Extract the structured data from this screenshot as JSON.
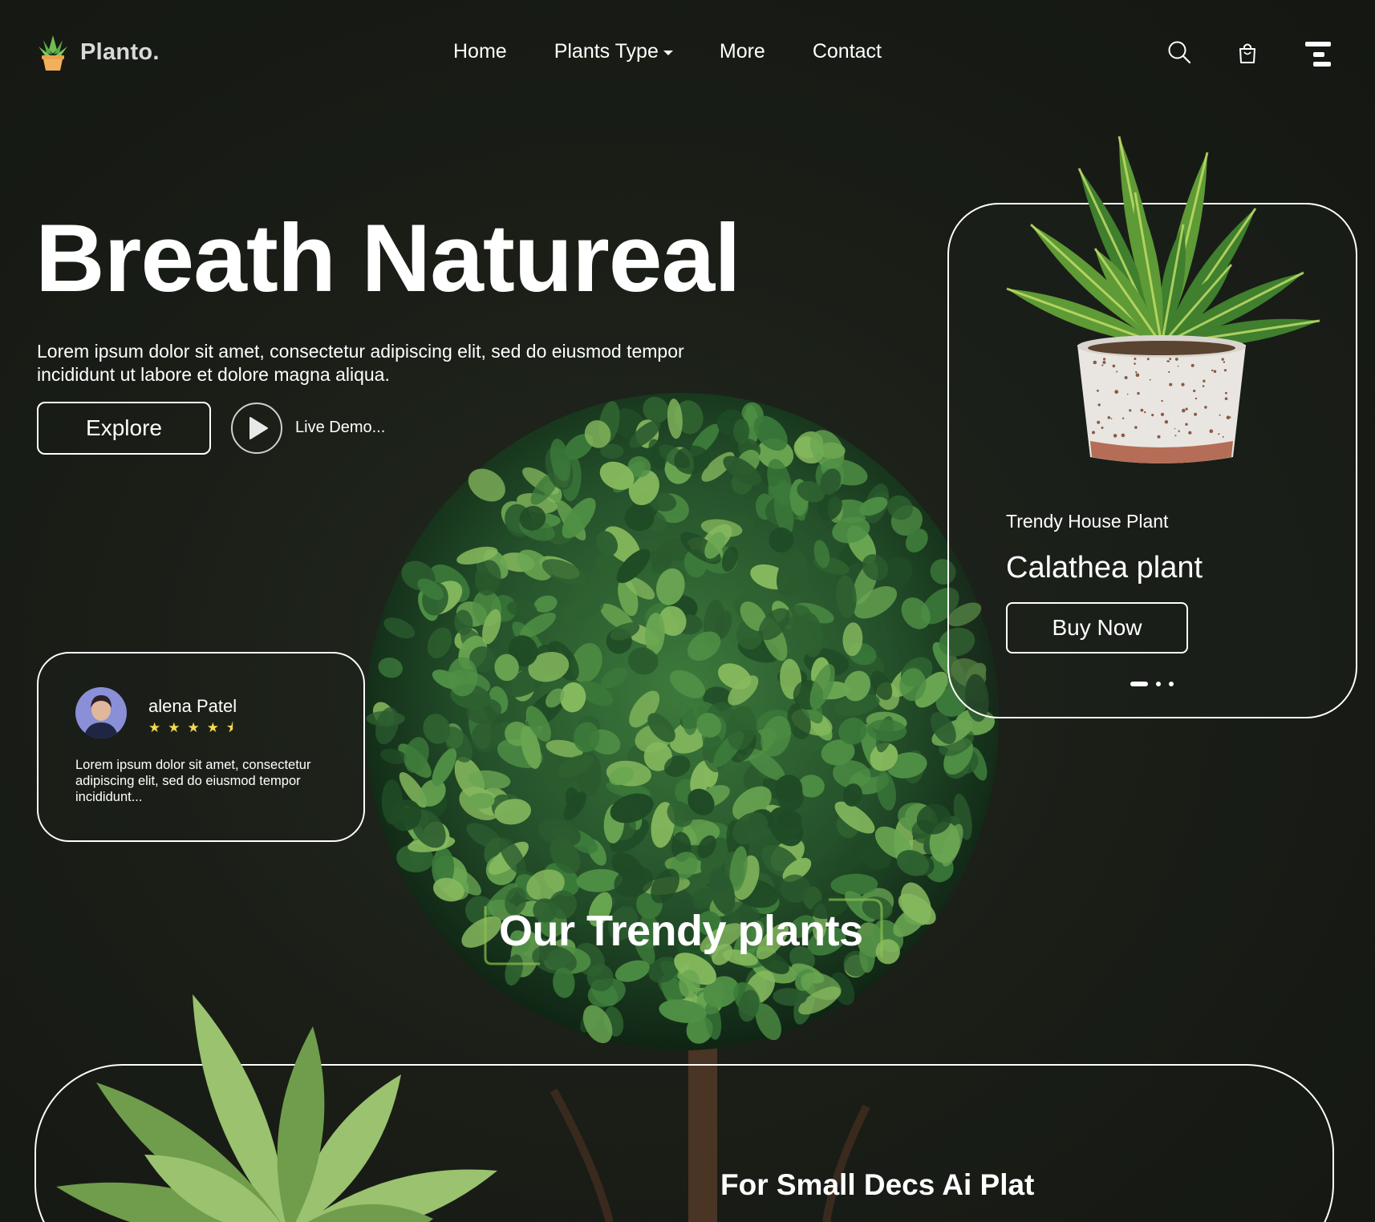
{
  "colors": {
    "background": "#1a1e17",
    "foreground": "#ffffff",
    "star": "#f2d94e",
    "accent_green": "#8dbf4e"
  },
  "brand": {
    "name": "Planto.",
    "logo_icon": "potted-plant-icon"
  },
  "nav": {
    "items": [
      {
        "label": "Home"
      },
      {
        "label": "Plants Type",
        "has_dropdown": true
      },
      {
        "label": "More"
      },
      {
        "label": "Contact"
      }
    ],
    "icons": [
      "search-icon",
      "shopping-bag-icon",
      "menu-icon"
    ]
  },
  "hero": {
    "title": "Breath Natureal",
    "description": "Lorem ipsum dolor sit amet, consectetur adipiscing elit, sed do eiusmod tempor incididunt ut labore et dolore magna aliqua.",
    "explore_label": "Explore",
    "live_demo_label": "Live Demo..."
  },
  "product": {
    "subtitle": "Trendy House Plant",
    "name": "Calathea plant",
    "buy_label": "Buy Now",
    "carousel": {
      "count": 3,
      "active": 0
    }
  },
  "review": {
    "name": "alena Patel",
    "rating": 4.5,
    "stars_text": "★★★★⯨",
    "text": "Lorem ipsum dolor sit amet, consectetur adipiscing elit, sed do eiusmod tempor incididunt..."
  },
  "section": {
    "title": "Our Trendy plants",
    "card_title": "For Small Decs Ai Plat"
  }
}
